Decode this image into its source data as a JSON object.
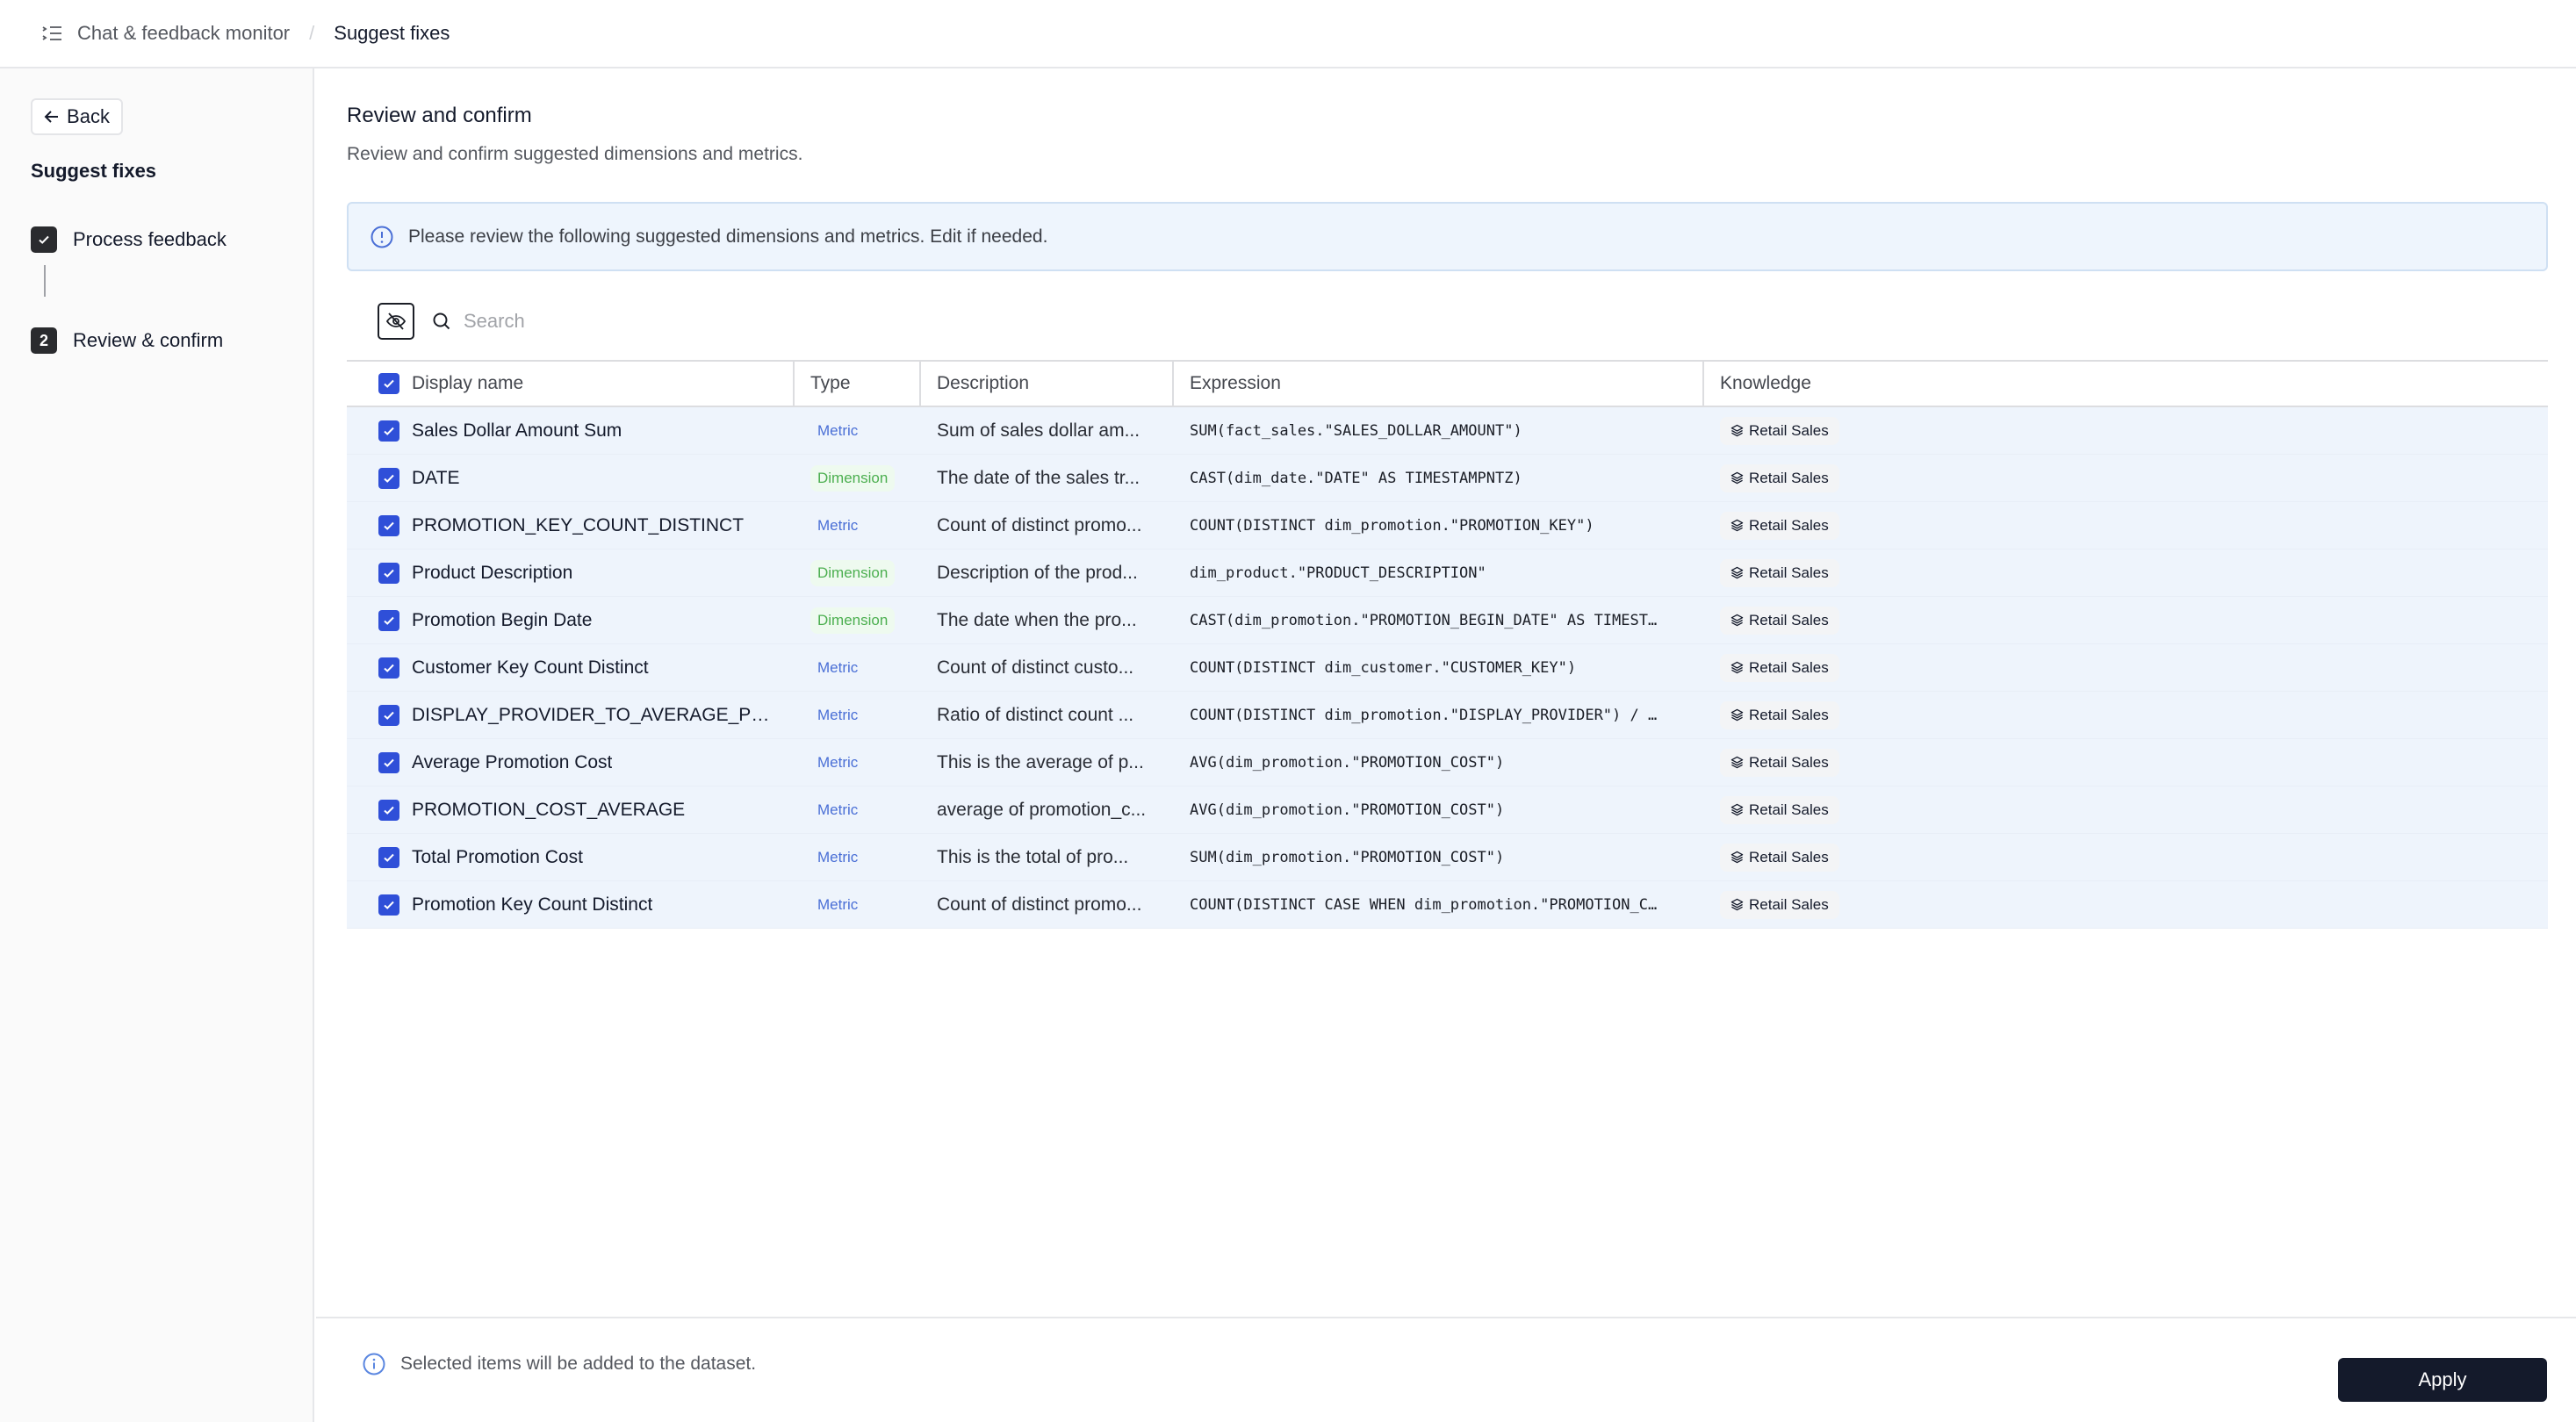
{
  "header": {
    "menu_icon": "list-collapse-icon",
    "breadcrumb": [
      "Chat & feedback monitor",
      "Suggest fixes"
    ],
    "separator": "/"
  },
  "sidebar": {
    "back_label": "Back",
    "title": "Suggest fixes",
    "steps": [
      {
        "label": "Process feedback",
        "status": "completed",
        "marker": "✓"
      },
      {
        "label": "Review & confirm",
        "status": "current",
        "marker": "2"
      }
    ]
  },
  "main": {
    "title": "Review and confirm",
    "subtitle": "Review and confirm suggested dimensions and metrics.",
    "banner": "Please review the following suggested dimensions and metrics. Edit if needed.",
    "search_placeholder": "Search",
    "table": {
      "columns": [
        "Display name",
        "Type",
        "Description",
        "Expression",
        "Knowledge"
      ],
      "select_all_checked": true,
      "rows": [
        {
          "checked": true,
          "name": "Sales Dollar Amount Sum",
          "type": "Metric",
          "description": "Sum of sales dollar am...",
          "expression": "SUM(fact_sales.\"SALES_DOLLAR_AMOUNT\")",
          "knowledge": "Retail Sales"
        },
        {
          "checked": true,
          "name": "DATE",
          "type": "Dimension",
          "description": "The date of the sales tr...",
          "expression": "CAST(dim_date.\"DATE\" AS TIMESTAMPNTZ)",
          "knowledge": "Retail Sales"
        },
        {
          "checked": true,
          "name": "PROMOTION_KEY_COUNT_DISTINCT",
          "type": "Metric",
          "description": "Count of distinct promo...",
          "expression": "COUNT(DISTINCT dim_promotion.\"PROMOTION_KEY\")",
          "knowledge": "Retail Sales"
        },
        {
          "checked": true,
          "name": "Product Description",
          "type": "Dimension",
          "description": "Description of the prod...",
          "expression": "dim_product.\"PRODUCT_DESCRIPTION\"",
          "knowledge": "Retail Sales"
        },
        {
          "checked": true,
          "name": "Promotion Begin Date",
          "type": "Dimension",
          "description": "The date when the pro...",
          "expression": "CAST(dim_promotion.\"PROMOTION_BEGIN_DATE\" AS TIMEST…",
          "knowledge": "Retail Sales"
        },
        {
          "checked": true,
          "name": "Customer Key Count Distinct",
          "type": "Metric",
          "description": "Count of distinct custo...",
          "expression": "COUNT(DISTINCT dim_customer.\"CUSTOMER_KEY\")",
          "knowledge": "Retail Sales"
        },
        {
          "checked": true,
          "name": "DISPLAY_PROVIDER_TO_AVERAGE_PRO...",
          "type": "Metric",
          "description": "Ratio of distinct count ...",
          "expression": "COUNT(DISTINCT dim_promotion.\"DISPLAY_PROVIDER\") / …",
          "knowledge": "Retail Sales"
        },
        {
          "checked": true,
          "name": "Average Promotion Cost",
          "type": "Metric",
          "description": "This is the average of p...",
          "expression": "AVG(dim_promotion.\"PROMOTION_COST\")",
          "knowledge": "Retail Sales"
        },
        {
          "checked": true,
          "name": "PROMOTION_COST_AVERAGE",
          "type": "Metric",
          "description": "average of promotion_c...",
          "expression": "AVG(dim_promotion.\"PROMOTION_COST\")",
          "knowledge": "Retail Sales"
        },
        {
          "checked": true,
          "name": "Total Promotion Cost",
          "type": "Metric",
          "description": "This is the total of pro...",
          "expression": "SUM(dim_promotion.\"PROMOTION_COST\")",
          "knowledge": "Retail Sales"
        },
        {
          "checked": true,
          "name": "Promotion Key Count Distinct",
          "type": "Metric",
          "description": "Count of distinct promo...",
          "expression": "COUNT(DISTINCT CASE WHEN dim_promotion.\"PROMOTION_C…",
          "knowledge": "Retail Sales"
        }
      ]
    }
  },
  "footer": {
    "info": "Selected items will be added to the dataset.",
    "apply_label": "Apply"
  },
  "colors": {
    "accent": "#2f4fd8",
    "metric": "#4a6fd6",
    "dimension": "#4caf50",
    "primary_button": "#141a2b",
    "banner_bg": "#eef5fd",
    "row_bg": "#eef4fc"
  }
}
